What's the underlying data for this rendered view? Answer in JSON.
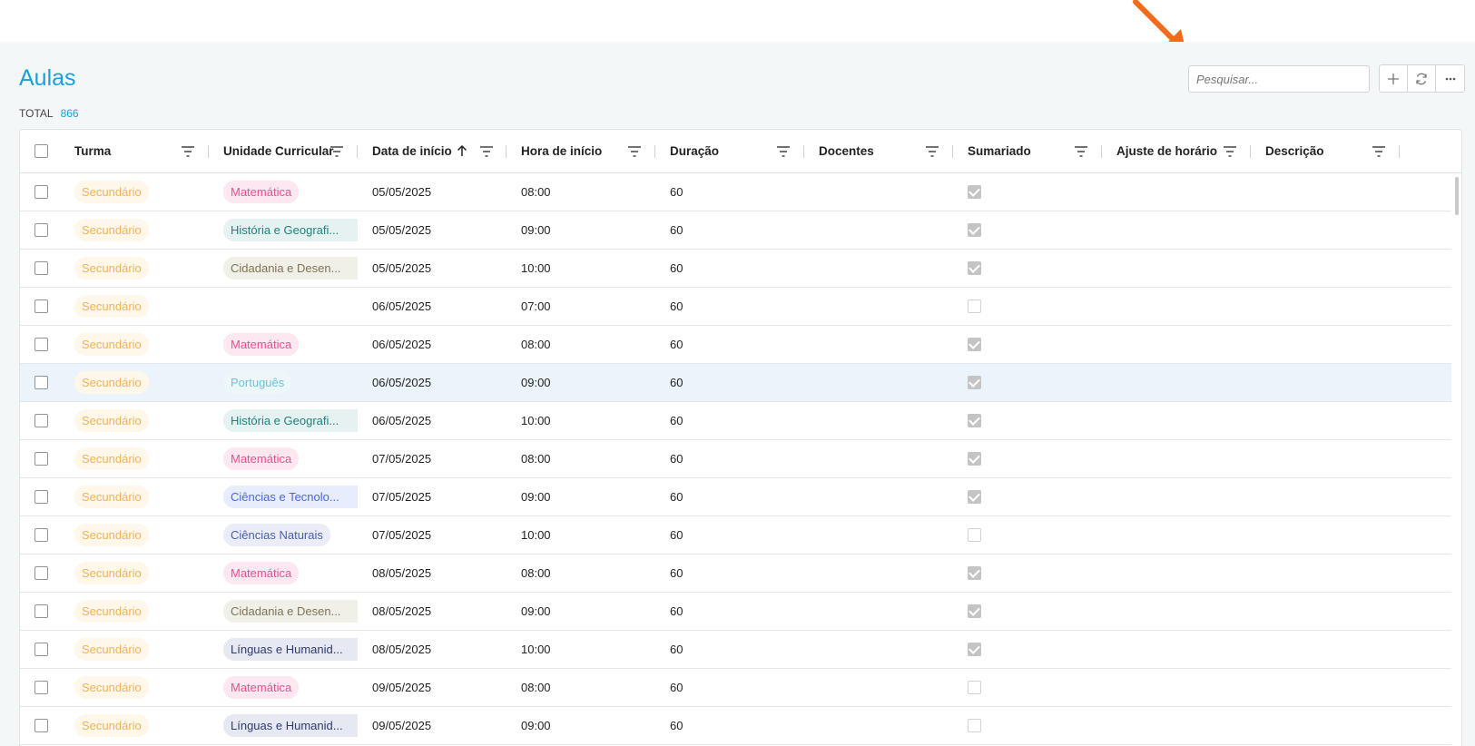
{
  "page": {
    "title": "Aulas",
    "total_label": "TOTAL",
    "total_value": "866"
  },
  "search": {
    "placeholder": "Pesquisar..."
  },
  "toolbar": {
    "add_icon": "+",
    "refresh_icon": "refresh-icon",
    "more_icon": "···"
  },
  "columns": [
    "Turma",
    "Unidade Curricular",
    "Data de início",
    "Hora de início",
    "Duração",
    "Docentes",
    "Sumariado",
    "Ajuste de horário",
    "Descrição"
  ],
  "colors": {
    "accent": "#1aa0d9",
    "arrow": "#f26a1b",
    "Matemática": {
      "bg": "#fde8f1",
      "fg": "#e4528f"
    },
    "História e Geografia": {
      "bg": "#e6f2f1",
      "fg": "#1f7f7b"
    },
    "Cidadania e Desenvolvimento": {
      "bg": "#f1f0e8",
      "fg": "#7a7453"
    },
    "Português": {
      "bg": "#edf7fa",
      "fg": "#6cc3d8"
    },
    "Ciências e Tecnologia": {
      "bg": "#e8edfd",
      "fg": "#4b66de"
    },
    "Ciências Naturais": {
      "bg": "#eaedf8",
      "fg": "#4a5ea8"
    },
    "Línguas e Humanidades": {
      "bg": "#e6e8f2",
      "fg": "#2f3a6b"
    }
  },
  "rows": [
    {
      "turma": "Secundário",
      "uc": "Matemática",
      "uc_key": "Matemática",
      "data": "05/05/2025",
      "hora": "08:00",
      "duracao": "60",
      "docentes": "",
      "sumariado": true,
      "ajuste": "",
      "descricao": ""
    },
    {
      "turma": "Secundário",
      "uc": "História e Geografi...",
      "uc_key": "História e Geografia",
      "data": "05/05/2025",
      "hora": "09:00",
      "duracao": "60",
      "docentes": "",
      "sumariado": true,
      "ajuste": "",
      "descricao": ""
    },
    {
      "turma": "Secundário",
      "uc": "Cidadania e Desen...",
      "uc_key": "Cidadania e Desenvolvimento",
      "data": "05/05/2025",
      "hora": "10:00",
      "duracao": "60",
      "docentes": "",
      "sumariado": true,
      "ajuste": "",
      "descricao": ""
    },
    {
      "turma": "Secundário",
      "uc": "",
      "uc_key": "",
      "data": "06/05/2025",
      "hora": "07:00",
      "duracao": "60",
      "docentes": "",
      "sumariado": false,
      "ajuste": "",
      "descricao": ""
    },
    {
      "turma": "Secundário",
      "uc": "Matemática",
      "uc_key": "Matemática",
      "data": "06/05/2025",
      "hora": "08:00",
      "duracao": "60",
      "docentes": "",
      "sumariado": true,
      "ajuste": "",
      "descricao": ""
    },
    {
      "turma": "Secundário",
      "uc": "Português",
      "uc_key": "Português",
      "data": "06/05/2025",
      "hora": "09:00",
      "duracao": "60",
      "docentes": "",
      "sumariado": true,
      "ajuste": "",
      "descricao": "",
      "selected": true
    },
    {
      "turma": "Secundário",
      "uc": "História e Geografi...",
      "uc_key": "História e Geografia",
      "data": "06/05/2025",
      "hora": "10:00",
      "duracao": "60",
      "docentes": "",
      "sumariado": true,
      "ajuste": "",
      "descricao": ""
    },
    {
      "turma": "Secundário",
      "uc": "Matemática",
      "uc_key": "Matemática",
      "data": "07/05/2025",
      "hora": "08:00",
      "duracao": "60",
      "docentes": "",
      "sumariado": true,
      "ajuste": "",
      "descricao": ""
    },
    {
      "turma": "Secundário",
      "uc": "Ciências e Tecnolo...",
      "uc_key": "Ciências e Tecnologia",
      "data": "07/05/2025",
      "hora": "09:00",
      "duracao": "60",
      "docentes": "",
      "sumariado": true,
      "ajuste": "",
      "descricao": ""
    },
    {
      "turma": "Secundário",
      "uc": "Ciências Naturais",
      "uc_key": "Ciências Naturais",
      "data": "07/05/2025",
      "hora": "10:00",
      "duracao": "60",
      "docentes": "",
      "sumariado": false,
      "ajuste": "",
      "descricao": ""
    },
    {
      "turma": "Secundário",
      "uc": "Matemática",
      "uc_key": "Matemática",
      "data": "08/05/2025",
      "hora": "08:00",
      "duracao": "60",
      "docentes": "",
      "sumariado": true,
      "ajuste": "",
      "descricao": ""
    },
    {
      "turma": "Secundário",
      "uc": "Cidadania e Desen...",
      "uc_key": "Cidadania e Desenvolvimento",
      "data": "08/05/2025",
      "hora": "09:00",
      "duracao": "60",
      "docentes": "",
      "sumariado": true,
      "ajuste": "",
      "descricao": ""
    },
    {
      "turma": "Secundário",
      "uc": "Línguas e Humanid...",
      "uc_key": "Línguas e Humanidades",
      "data": "08/05/2025",
      "hora": "10:00",
      "duracao": "60",
      "docentes": "",
      "sumariado": true,
      "ajuste": "",
      "descricao": ""
    },
    {
      "turma": "Secundário",
      "uc": "Matemática",
      "uc_key": "Matemática",
      "data": "09/05/2025",
      "hora": "08:00",
      "duracao": "60",
      "docentes": "",
      "sumariado": false,
      "ajuste": "",
      "descricao": ""
    },
    {
      "turma": "Secundário",
      "uc": "Línguas e Humanid...",
      "uc_key": "Línguas e Humanidades",
      "data": "09/05/2025",
      "hora": "09:00",
      "duracao": "60",
      "docentes": "",
      "sumariado": false,
      "ajuste": "",
      "descricao": ""
    }
  ]
}
